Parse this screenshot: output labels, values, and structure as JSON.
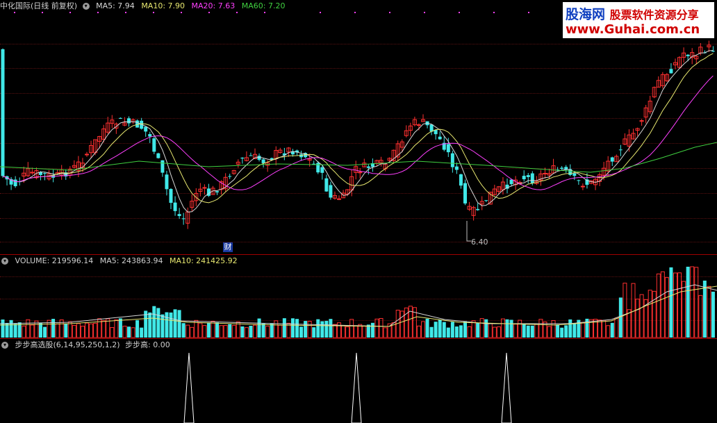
{
  "main_panel": {
    "title": "中化国际(日线 前复权)",
    "ma_labels": [
      {
        "text": "MA5: 7.94",
        "color": "#d8d8d8"
      },
      {
        "text": "MA10: 7.90",
        "color": "#e8e870"
      },
      {
        "text": "MA20: 7.63",
        "color": "#ff40ff"
      },
      {
        "text": "MA60: 7.20",
        "color": "#40d040"
      }
    ],
    "low_marker": "6.40",
    "finance_marker": "财"
  },
  "volume_panel": {
    "labels": [
      {
        "text": "VOLUME: 219596.14",
        "color": "#d0d0d0"
      },
      {
        "text": "MA5: 243863.94",
        "color": "#d0d0d0"
      },
      {
        "text": "MA10: 241425.92",
        "color": "#e8e870"
      }
    ]
  },
  "indicator_panel": {
    "title": "步步高选股(6,14,95,250,1,2)",
    "value_label": "步步高: 0.00",
    "signals": [
      1,
      1,
      1
    ]
  },
  "watermark": {
    "line1_a": "股海网",
    "line1_b": "股票软件资源分享",
    "line2": "www.Guhai.com.cn"
  },
  "colors": {
    "up": "#ff3030",
    "down": "#40e8e8",
    "ma5": "#d8d8d8",
    "ma10": "#e8e870",
    "ma20": "#ff40ff",
    "ma60": "#40d040",
    "separator": "#a00000",
    "background": "#000000"
  }
}
